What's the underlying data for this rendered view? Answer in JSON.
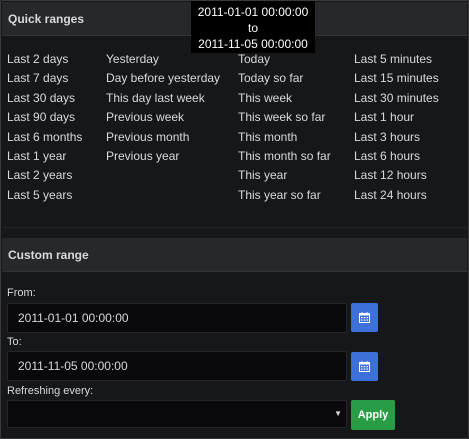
{
  "tooltip": {
    "line1": "2011-01-01 00:00:00",
    "line2": "to",
    "line3": "2011-11-05 00:00:00"
  },
  "quick_ranges": {
    "title": "Quick ranges",
    "columns": [
      [
        "Last 2 days",
        "Last 7 days",
        "Last 30 days",
        "Last 90 days",
        "Last 6 months",
        "Last 1 year",
        "Last 2 years",
        "Last 5 years"
      ],
      [
        "Yesterday",
        "Day before yesterday",
        "This day last week",
        "Previous week",
        "Previous month",
        "Previous year"
      ],
      [
        "Today",
        "Today so far",
        "This week",
        "This week so far",
        "This month",
        "This month so far",
        "This year",
        "This year so far"
      ],
      [
        "Last 5 minutes",
        "Last 15 minutes",
        "Last 30 minutes",
        "Last 1 hour",
        "Last 3 hours",
        "Last 6 hours",
        "Last 12 hours",
        "Last 24 hours"
      ]
    ]
  },
  "custom_range": {
    "title": "Custom range",
    "from_label": "From:",
    "from_value": "2011-01-01 00:00:00",
    "to_label": "To:",
    "to_value": "2011-11-05 00:00:00",
    "refresh_label": "Refreshing every:",
    "refresh_value": "",
    "calendar_icon": "calendar-icon",
    "apply_label": "Apply"
  },
  "colors": {
    "accent_blue": "#3d71d9",
    "apply_green": "#299c46",
    "background": "#161719"
  }
}
